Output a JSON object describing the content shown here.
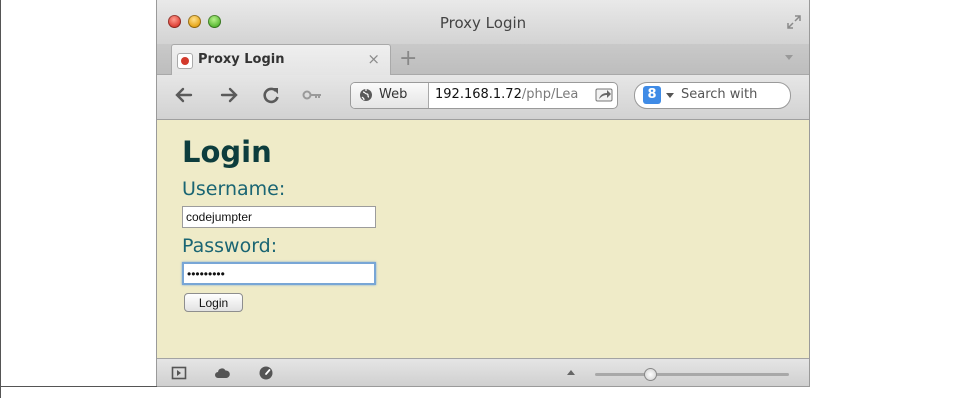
{
  "window": {
    "title": "Proxy Login"
  },
  "tab": {
    "title": "Proxy Login",
    "close_glyph": "×",
    "new_tab_glyph": "+"
  },
  "toolbar": {
    "address_mode": "Web",
    "address_host": "192.168.1.72",
    "address_path": "/php/Lea",
    "search_engine": "8",
    "search_placeholder": "Search with"
  },
  "page": {
    "heading": "Login",
    "username_label": "Username:",
    "username_value": "codejumpter",
    "password_label": "Password:",
    "password_value": "•••••••••",
    "login_button": "Login"
  },
  "statusbar": {
    "zoom_fraction": 0.27
  },
  "icons": [
    "back-icon",
    "forward-icon",
    "reload-icon",
    "key-icon",
    "globe-icon",
    "share-icon",
    "fullscreen-icon",
    "reader-icon",
    "cloud-icon",
    "speedometer-icon"
  ],
  "colors": {
    "page_background": "#efebc8",
    "heading": "#0d3d3d",
    "label": "#1a6573"
  }
}
